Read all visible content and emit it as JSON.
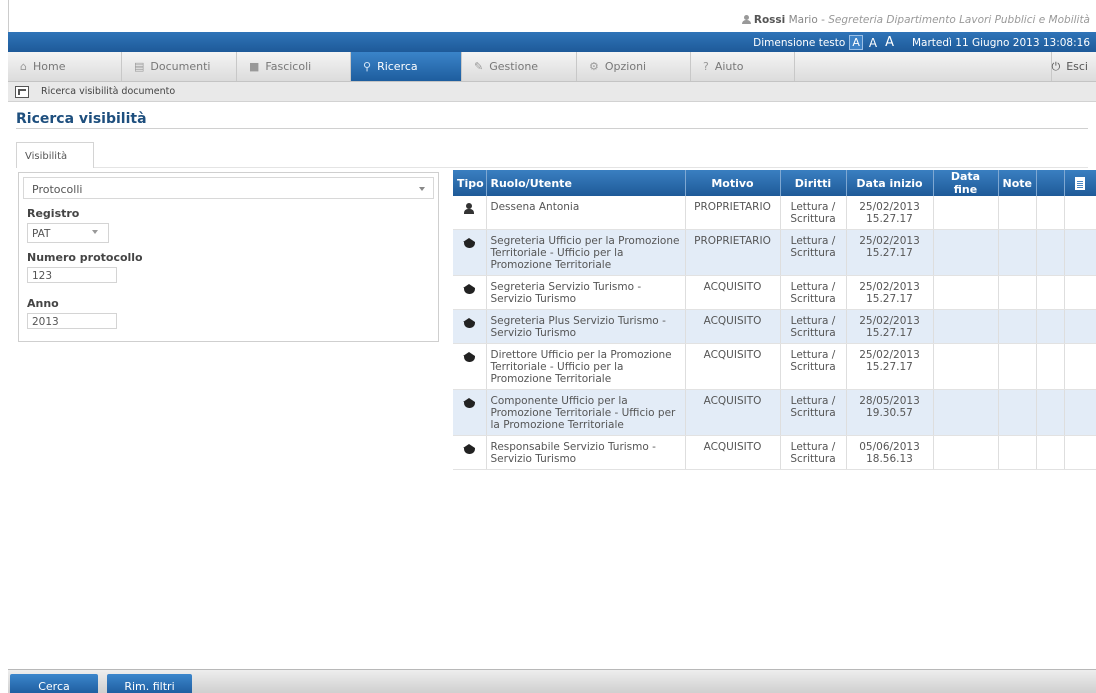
{
  "user": {
    "surname": "Rossi",
    "name": "Mario",
    "office": "Segreteria Dipartimento Lavori Pubblici e Mobilità"
  },
  "infobar": {
    "text_size_label": "Dimensione testo",
    "sizes": [
      "A",
      "A",
      "A"
    ],
    "datetime": "Martedì 11 Giugno 2013 13:08:16"
  },
  "nav": {
    "tabs": [
      {
        "label": "Home",
        "icon": "home-icon"
      },
      {
        "label": "Documenti",
        "icon": "documents-icon"
      },
      {
        "label": "Fascicoli",
        "icon": "folder-icon"
      },
      {
        "label": "Ricerca",
        "icon": "search-icon",
        "active": true
      },
      {
        "label": "Gestione",
        "icon": "pencil-icon"
      },
      {
        "label": "Opzioni",
        "icon": "options-icon"
      },
      {
        "label": "Aiuto",
        "icon": "help-icon"
      }
    ],
    "exit_label": "Esci"
  },
  "breadcrumb": "Ricerca visibilità documento",
  "page_title": "Ricerca visibilità",
  "subtab": "Visibilità",
  "form": {
    "type_select": "Protocolli",
    "registro_label": "Registro",
    "registro_value": "PAT",
    "numero_label": "Numero protocollo",
    "numero_value": "123",
    "anno_label": "Anno",
    "anno_value": "2013"
  },
  "grid": {
    "headers": [
      "Tipo",
      "Ruolo/Utente",
      "Motivo",
      "Diritti",
      "Data inizio",
      "Data fine",
      "Note"
    ],
    "rows": [
      {
        "tipo": "user",
        "ruolo": "Dessena Antonia",
        "motivo": "PROPRIETARIO",
        "diritti": "Lettura / Scrittura",
        "data_inizio": "25/02/2013 15.27.17",
        "data_fine": "",
        "note": ""
      },
      {
        "tipo": "role",
        "ruolo": "Segreteria Ufficio per la Promozione Territoriale - Ufficio per la Promozione Territoriale",
        "motivo": "PROPRIETARIO",
        "diritti": "Lettura / Scrittura",
        "data_inizio": "25/02/2013 15.27.17",
        "data_fine": "",
        "note": ""
      },
      {
        "tipo": "role",
        "ruolo": "Segreteria Servizio Turismo - Servizio Turismo",
        "motivo": "ACQUISITO",
        "diritti": "Lettura / Scrittura",
        "data_inizio": "25/02/2013 15.27.17",
        "data_fine": "",
        "note": ""
      },
      {
        "tipo": "role",
        "ruolo": "Segreteria Plus Servizio Turismo - Servizio Turismo",
        "motivo": "ACQUISITO",
        "diritti": "Lettura / Scrittura",
        "data_inizio": "25/02/2013 15.27.17",
        "data_fine": "",
        "note": ""
      },
      {
        "tipo": "role",
        "ruolo": "Direttore Ufficio per la Promozione Territoriale - Ufficio per la Promozione Territoriale",
        "motivo": "ACQUISITO",
        "diritti": "Lettura / Scrittura",
        "data_inizio": "25/02/2013 15.27.17",
        "data_fine": "",
        "note": ""
      },
      {
        "tipo": "role",
        "ruolo": "Componente Ufficio per la Promozione Territoriale - Ufficio per la Promozione Territoriale",
        "motivo": "ACQUISITO",
        "diritti": "Lettura / Scrittura",
        "data_inizio": "28/05/2013 19.30.57",
        "data_fine": "",
        "note": ""
      },
      {
        "tipo": "role",
        "ruolo": "Responsabile Servizio Turismo - Servizio Turismo",
        "motivo": "ACQUISITO",
        "diritti": "Lettura / Scrittura",
        "data_inizio": "05/06/2013 18.56.13",
        "data_fine": "",
        "note": ""
      }
    ]
  },
  "buttons": {
    "search": "Cerca",
    "clear_filters": "Rim. filtri"
  }
}
